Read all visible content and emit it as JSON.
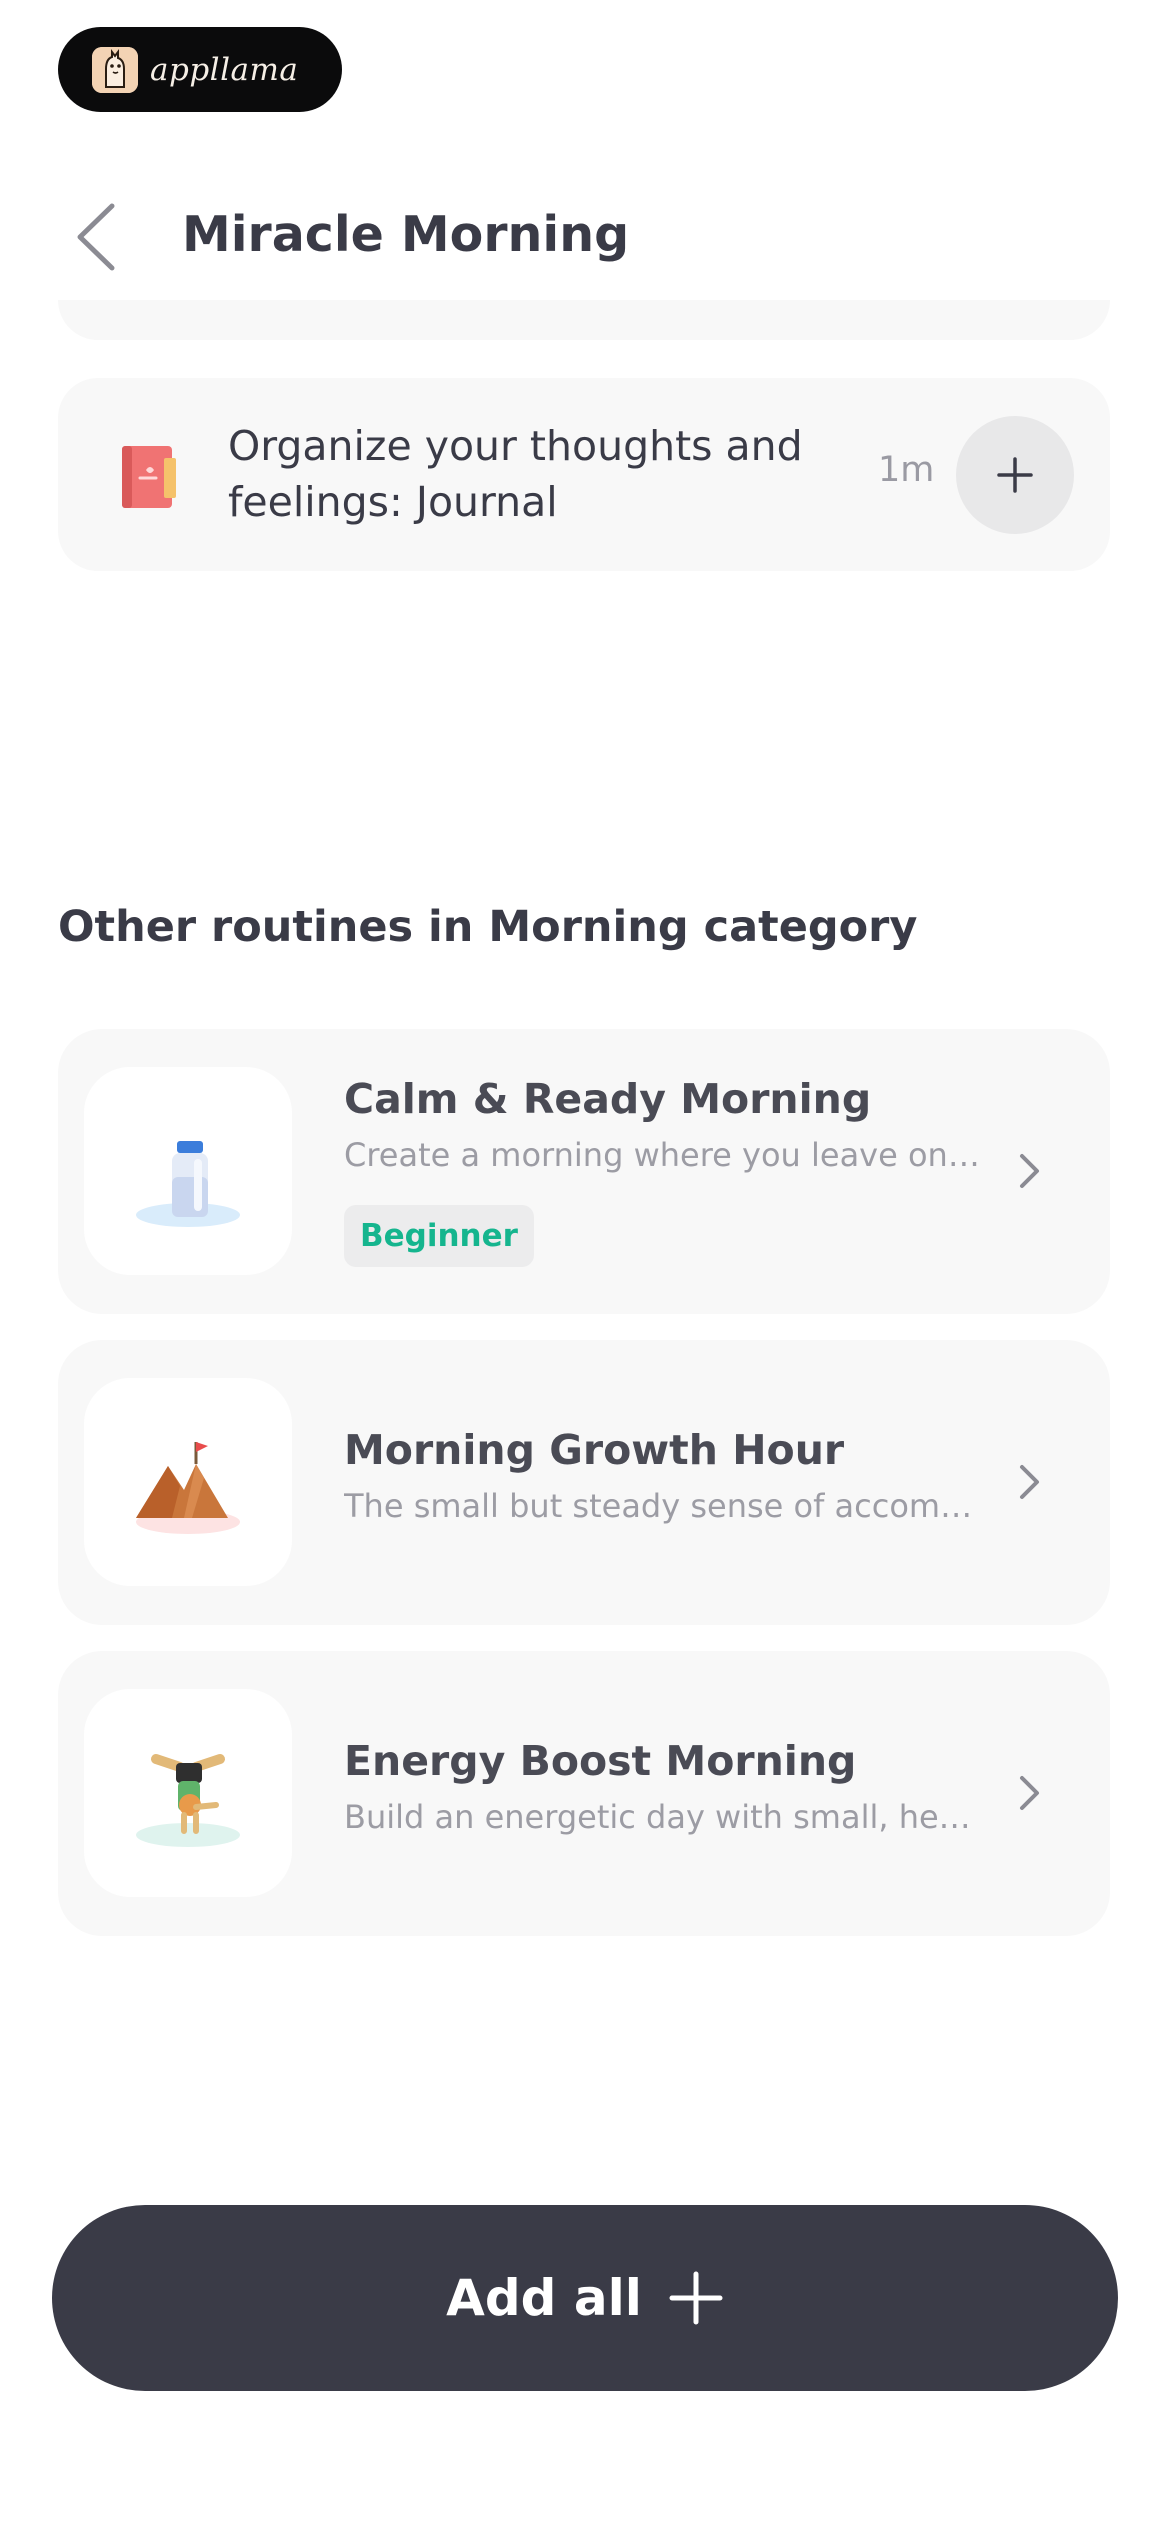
{
  "brand": {
    "name": "appllama"
  },
  "header": {
    "title": "Miracle Morning",
    "back_icon": "chevron-left-icon"
  },
  "task": {
    "title": "Organize your thoughts and feelings: Journal",
    "duration": "1m",
    "icon": "journal-book-icon",
    "add_icon": "plus-icon"
  },
  "section": {
    "title": "Other routines in Morning category"
  },
  "routines": [
    {
      "name": "Calm & Ready Morning",
      "description": "Create a morning where you leave on time feeling calm and ready",
      "badge": "Beginner",
      "icon": "water-bottle-icon"
    },
    {
      "name": "Morning Growth Hour",
      "description": "The small but steady sense of accomplishment that builds every morning",
      "icon": "mountain-flag-icon"
    },
    {
      "name": "Energy Boost Morning",
      "description": "Build an energetic day with small, healthy habits",
      "icon": "handstand-person-icon"
    }
  ],
  "cta": {
    "label": "Add all",
    "icon": "plus-icon"
  },
  "colors": {
    "primary_dark": "#3a3b47",
    "card_bg": "#f8f8f8",
    "badge_text": "#15b58e",
    "muted_text": "#9c9ca4"
  }
}
